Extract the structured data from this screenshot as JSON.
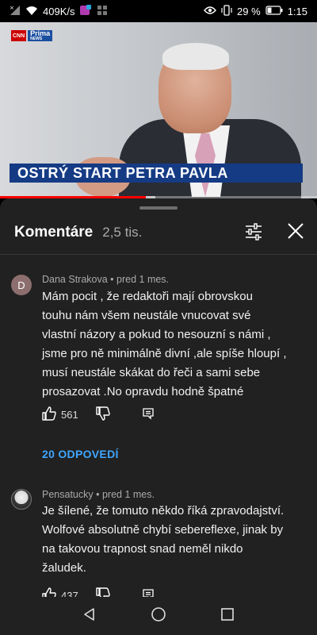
{
  "status_bar": {
    "network_speed": "409K/s",
    "battery_percent": "29 %",
    "time": "1:15"
  },
  "video": {
    "brand_top": "CNN",
    "brand_main": "Prima",
    "brand_sub": "NEWS",
    "caption": "OSTRÝ START PETRA PAVLA",
    "progress_played_fraction": 0.46,
    "progress_buffered_fraction": 0.49
  },
  "comments_sheet": {
    "title": "Komentáre",
    "count": "2,5 tis.",
    "comments": [
      {
        "avatar_letter": "D",
        "author": "Dana Strakova",
        "time": "pred 1 mes.",
        "lines": [
          "Mám  pocit , že redaktoři mají obrovskou",
          "touhu nám všem neustále vnucovat své",
          "vlastní názory a pokud to nesouzní s námi ,",
          "jsme pro ně minimálně divní ,ale spíše hloupí ,",
          "musí neustále skákat do řeči a sami sebe",
          "prosazovat .No opravdu  hodně špatné"
        ],
        "likes": "561",
        "replies_label": "20 ODPOVEDÍ"
      },
      {
        "avatar_letter": "",
        "author": "Pensatucky",
        "time": "pred 1 mes.",
        "lines": [
          "Je šílené, že tomuto někdo říká zpravodajství.",
          "Wolfové absolutně chybí sebereflexe, jinak by",
          "na takovou trapnost snad neměl nikdo",
          "žaludek."
        ],
        "likes": "437"
      }
    ]
  },
  "icons": {
    "filter": "sliders-icon",
    "close": "close-icon",
    "like": "thumbs-up-icon",
    "dislike": "thumbs-down-icon",
    "reply": "reply-comment-icon",
    "nav_back": "triangle-back-icon",
    "nav_home": "circle-home-icon",
    "nav_recents": "square-recents-icon"
  },
  "colors": {
    "sheet_bg": "#212121",
    "link_blue": "#3ea6ff",
    "progress_red": "#ff0000",
    "caption_bar": "#153b85"
  }
}
